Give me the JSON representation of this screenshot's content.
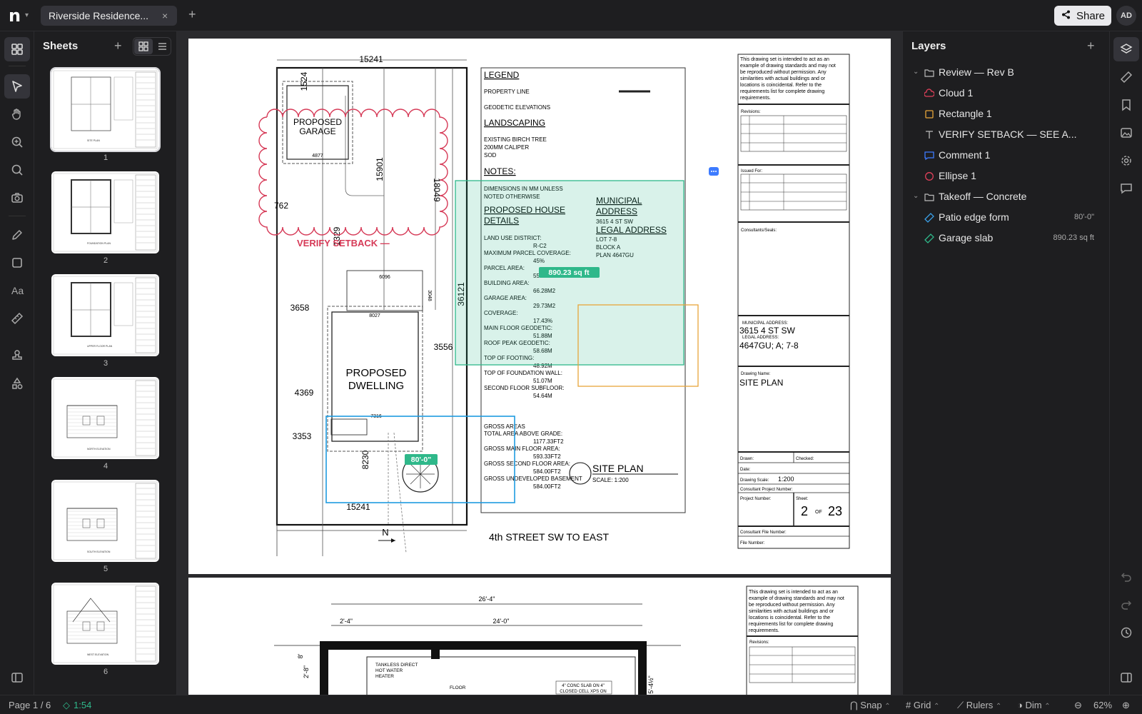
{
  "app": {
    "logo": "n"
  },
  "tab": {
    "title": "Riverside Residence...",
    "close": "×",
    "add": "+"
  },
  "share": {
    "icon": "⋖",
    "label": "Share"
  },
  "user": {
    "initials": "AD"
  },
  "sheets": {
    "title": "Sheets",
    "add": "+",
    "thumbnails": [
      {
        "number": "1",
        "caption": "SITE PLAN"
      },
      {
        "number": "2",
        "caption": "FOUNDATION PLAN"
      },
      {
        "number": "3",
        "caption": "UPPER FLOOR PLAN"
      },
      {
        "number": "4",
        "caption": "NORTH ELEVATION"
      },
      {
        "number": "5",
        "caption": "SOUTH ELEVATION"
      },
      {
        "number": "6",
        "caption": "WEST ELEVATION"
      }
    ]
  },
  "drawing": {
    "dims": {
      "top": "15241",
      "left_top": "1524",
      "garage_depth": "15901",
      "right": "18049",
      "d762": "762",
      "d1329": "1329",
      "d36121": "36121",
      "d3658": "3658",
      "d3556": "3556",
      "d4369": "4369",
      "d3353": "3353",
      "d8230": "8230",
      "bottom": "15241",
      "d6096": "6096",
      "d8027": "8027",
      "d7316": "7316",
      "d4877": "4877",
      "d3048": "3048"
    },
    "garage": [
      "PROPOSED",
      "GARAGE"
    ],
    "dwelling": [
      "PROPOSED",
      "DWELLING"
    ],
    "verify_text": "VERIFY SETBACK —",
    "measure_label": "80'-0\"",
    "area_label": "890.23 sq ft",
    "street": "4th STREET SW TO EAST",
    "north": "N",
    "legend": {
      "title": "LEGEND",
      "property_line": "PROPERTY LINE",
      "geodetic": "GEODETIC ELEVATIONS",
      "landscaping": "LANDSCAPING",
      "birch": [
        "EXISTING BIRCH TREE",
        "200MM CALIPER",
        "SOD"
      ],
      "notes": "NOTES:",
      "notes_text": [
        "DIMENSIONS IN MM UNLESS",
        "NOTED OTHERWISE"
      ],
      "house_details": [
        "PROPOSED HOUSE",
        "DETAILS"
      ],
      "municipal": [
        "MUNICIPAL",
        "ADDRESS"
      ],
      "municipal_value": "3615 4 ST SW",
      "legal": "LEGAL ADDRESS",
      "legal_values": [
        "LOT 7-8",
        "BLOCK A",
        "PLAN 4647GU"
      ],
      "details": [
        [
          "LAND USE DISTRICT:",
          "R-C2"
        ],
        [
          "MAXIMUM PARCEL COVERAGE:",
          "45%"
        ],
        [
          "PARCEL AREA:",
          "550.52M2"
        ],
        [
          "BUILDING AREA:",
          "66.28M2"
        ],
        [
          "GARAGE AREA:",
          "29.73M2"
        ],
        [
          "COVERAGE:",
          "17.43%"
        ],
        [
          "MAIN FLOOR GEODETIC:",
          "51.88M"
        ],
        [
          "ROOF PEAK GEODETIC:",
          "58.68M"
        ],
        [
          "TOP OF FOOTING:",
          "48.92M"
        ],
        [
          "TOP OF FOUNDATION WALL:",
          "51.07M"
        ],
        [
          "SECOND FLOOR SUBFLOOR:",
          "54.64M"
        ]
      ],
      "gross_title": "GROSS AREAS",
      "gross": [
        [
          "TOTAL AREA ABOVE GRADE:",
          "1177.33FT2"
        ],
        [
          "GROSS MAIN FLOOR AREA:",
          "593.33FT2"
        ],
        [
          "GROSS SECOND FLOOR AREA:",
          "584.00FT2"
        ],
        [
          "GROSS UNDEVELOPED BASEMENT",
          "584.00FT2"
        ]
      ],
      "site_plan": "SITE PLAN",
      "scale": "SCALE: 1:200"
    },
    "titleblock": {
      "disclaimer": [
        "This drawing set is intended to act as an",
        "example of drawing standards and may not",
        "be reproduced without permission. Any",
        "similarities with actual buildings and or",
        "locations is coincidental. Refer to the",
        "requirements list for complete drawing",
        "requirements."
      ],
      "revisions": "Revisions:",
      "issued_for": "Issued For:",
      "consultants": "Consultants/Seals:",
      "municipal_label": "MUNICIPAL ADDRESS:",
      "municipal": "3615 4 ST SW",
      "legal_label": "LEGAL ADDRESS:",
      "legal": "4647GU; A; 7-8",
      "drawing_name_label": "Drawing Name:",
      "drawing_name": "SITE PLAN",
      "drawn": "Drawn:",
      "checked": "Checked:",
      "date": "Date:",
      "drawing_scale": "Drawing Scale:",
      "scale_value": "1:200",
      "consultant_project": "Consultant Project Number:",
      "project_number": "Project Number:",
      "sheet_label": "Sheet:",
      "sheet": "2",
      "of": "OF",
      "total": "23",
      "consultant_file": "Consultant File Number:",
      "file_number": "File Number:"
    },
    "page2": {
      "dims": [
        "26'-4\"",
        "2'-4\"",
        "24'-0\"",
        "8'",
        "2'-8\"",
        "5'-4½\""
      ],
      "labels": [
        "TANKLESS DIRECT",
        "HOT WATER",
        "HEATER",
        "FLOOR",
        "4\" CONC SLAB ON 4\"",
        "CLOSED CELL XPS ON"
      ]
    }
  },
  "layers": {
    "title": "Layers",
    "add": "+",
    "groups": [
      {
        "name": "Review — Rev B",
        "items": [
          {
            "name": "Cloud 1",
            "icon": "cloud-icon",
            "color": "#e0405a"
          },
          {
            "name": "Rectangle 1",
            "icon": "rectangle-icon",
            "color": "#e8a53a"
          },
          {
            "name": "VERIFY SETBACK — SEE A...",
            "icon": "text-icon",
            "color": "#bbbbbb"
          },
          {
            "name": "Comment 1",
            "icon": "comment-icon",
            "color": "#3d7bff"
          },
          {
            "name": "Ellipse 1",
            "icon": "ellipse-icon",
            "color": "#e0405a"
          }
        ]
      },
      {
        "name": "Takeoff — Concrete",
        "items": [
          {
            "name": "Patio edge form",
            "icon": "ruler-icon",
            "color": "#3aa0e8",
            "measure": "80'-0\""
          },
          {
            "name": "Garage slab",
            "icon": "ruler-icon",
            "color": "#2fb88a",
            "measure": "890.23 sq ft"
          }
        ]
      }
    ]
  },
  "status": {
    "page": "Page 1 / 6",
    "timer": "1:54",
    "snap": "Snap",
    "grid": "Grid",
    "rulers": "Rulers",
    "dim": "Dim",
    "zoom": "62%"
  },
  "colors": {
    "cloud": "#d63a57",
    "rect": "#e8a53a",
    "area": "#2fb88a",
    "measure": "#1e9be0",
    "comment": "#3d7bff"
  }
}
